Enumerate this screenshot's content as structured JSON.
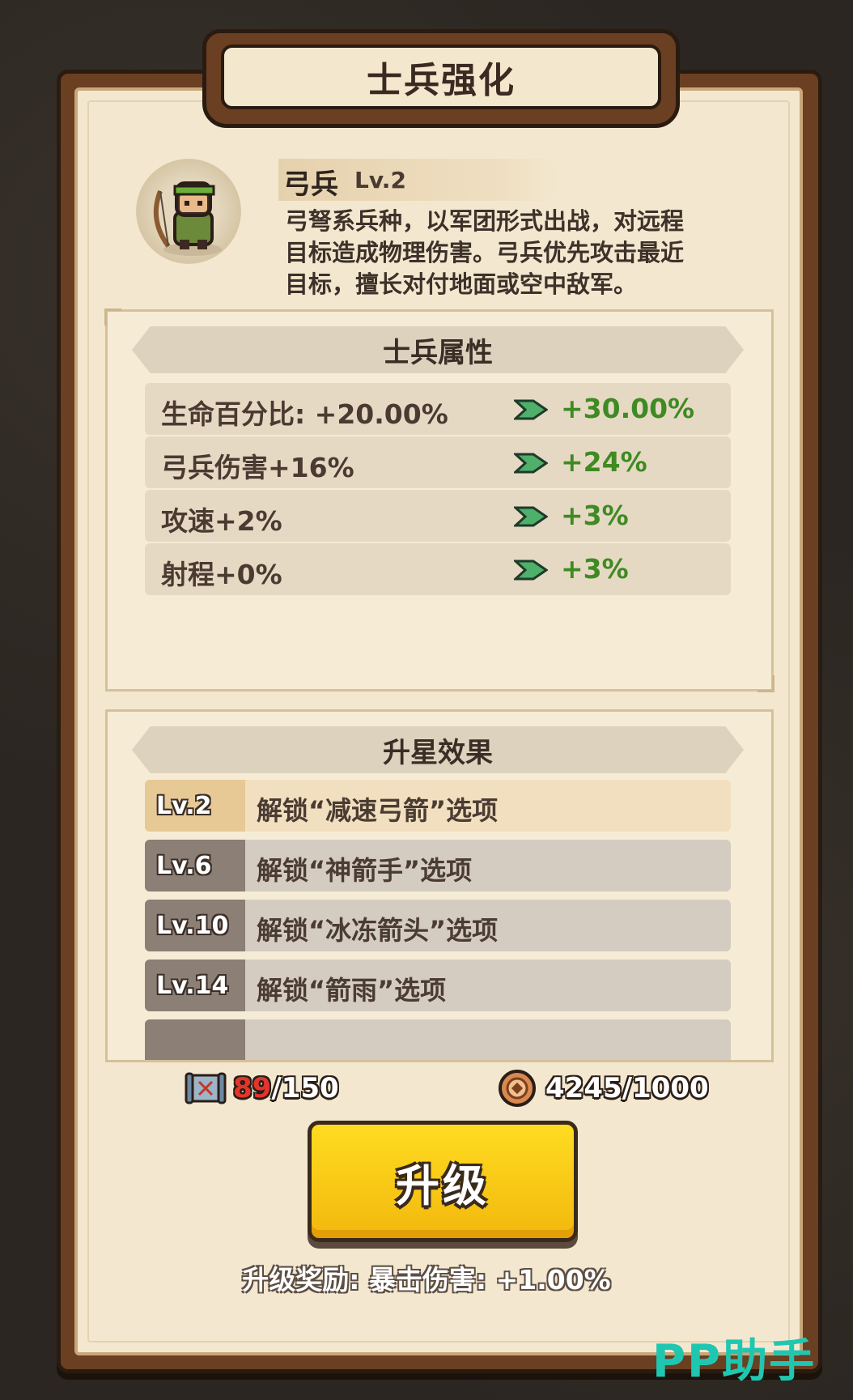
{
  "title": "士兵强化",
  "unit": {
    "name": "弓兵",
    "level": "Lv.2",
    "description_lines": [
      "弓弩系兵种，以军团形式出战，对远程",
      "目标造成物理伤害。弓兵优先攻击最近",
      "目标，擅长对付地面或空中敌军。"
    ]
  },
  "attributes": {
    "title": "士兵属性",
    "rows": [
      {
        "current": "生命百分比: +20.00%",
        "next": "+30.00%"
      },
      {
        "current": "弓兵伤害+16%",
        "next": "+24%"
      },
      {
        "current": "攻速+2%",
        "next": "+3%"
      },
      {
        "current": "射程+0%",
        "next": "+3%"
      }
    ]
  },
  "star_effects": {
    "title": "升星效果",
    "rows": [
      {
        "level": "Lv.2",
        "text": "解锁“减速弓箭”选项",
        "active": true
      },
      {
        "level": "Lv.6",
        "text": "解锁“神箭手”选项",
        "active": false
      },
      {
        "level": "Lv.10",
        "text": "解锁“冰冻箭头”选项",
        "active": false
      },
      {
        "level": "Lv.14",
        "text": "解锁“箭雨”选项",
        "active": false
      }
    ]
  },
  "resources": {
    "scrolls_current": "89",
    "scrolls_total": "/150",
    "coins": "4245/1000"
  },
  "upgrade_button": "升级",
  "upgrade_reward": "升级奖励: 暴击伤害: +1.00%",
  "watermark": "PP助手",
  "colors": {
    "accent_green": "#3f8a23",
    "button_yellow": "#ffd21c",
    "frame_brown": "#6a3f22",
    "shortfall_red": "#e5342b"
  }
}
